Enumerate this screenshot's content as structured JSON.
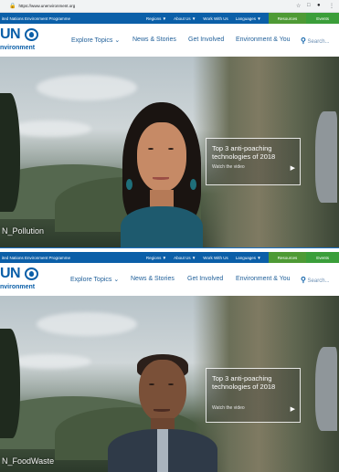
{
  "browser": {
    "url": "https://www.unenvironment.org"
  },
  "site": {
    "program_name": "ited Nations Environment Programme",
    "program_name_bottom": "ited Nations Environment Programme",
    "top_links": [
      "Regions",
      "About Us",
      "Work With Us",
      "Languages"
    ],
    "resources_label": "Resources",
    "events_label": "Events",
    "logo_un": "UN",
    "logo_env": "nvironment",
    "nav": [
      "Explore Topics",
      "News & Stories",
      "Get Involved",
      "Environment & You"
    ],
    "search_placeholder": "Search..."
  },
  "hero_top": {
    "promo_title": "Top 3 anti-poaching technologies of 2018",
    "promo_link": "Watch the video",
    "caption": "N_Pollution"
  },
  "hero_bottom": {
    "promo_title": "Top 3 anti-poaching technologies of 2018",
    "promo_link": "Watch the video",
    "caption": "N_FoodWaste"
  },
  "icons": {
    "lock": "lock-icon",
    "search": "search-icon",
    "chevron": "chevron-down-icon",
    "arrow": "play-arrow-icon"
  },
  "colors": {
    "un_blue": "#0b5fa8",
    "resources_green": "#4e9a35",
    "events_green": "#3b9e3a",
    "divider_blue": "#1d6fbf"
  }
}
